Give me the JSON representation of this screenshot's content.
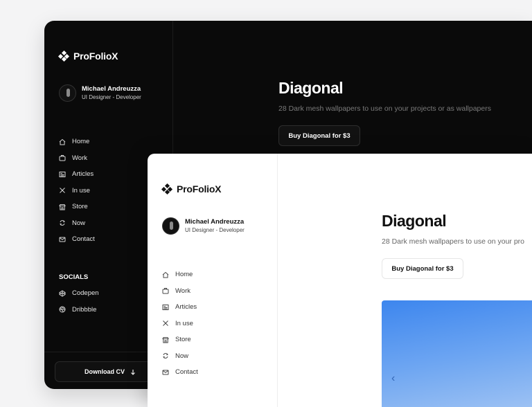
{
  "brand": {
    "name": "ProFolioX"
  },
  "profile": {
    "name": "Michael Andreuzza",
    "role": "UI Designer - Developer"
  },
  "nav": [
    {
      "label": "Home",
      "icon": "home-icon"
    },
    {
      "label": "Work",
      "icon": "briefcase-icon"
    },
    {
      "label": "Articles",
      "icon": "newspaper-icon"
    },
    {
      "label": "In use",
      "icon": "tools-icon"
    },
    {
      "label": "Store",
      "icon": "store-icon"
    },
    {
      "label": "Now",
      "icon": "refresh-icon"
    },
    {
      "label": "Contact",
      "icon": "mail-icon"
    }
  ],
  "socials": {
    "heading": "SOCIALS",
    "items": [
      {
        "label": "Codepen",
        "icon": "codepen-icon"
      },
      {
        "label": "Dribbble",
        "icon": "dribbble-icon"
      }
    ]
  },
  "download": {
    "label": "Download CV",
    "icon": "arrow-down-icon"
  },
  "product": {
    "title": "Diagonal",
    "subtitle": "28 Dark mesh wallpapers to use on your projects or as wallpapers",
    "subtitle_light": "28 Dark mesh wallpapers to use on your pro",
    "buy_label": "Buy Diagonal for $3"
  },
  "hero": {
    "prev_icon": "chevron-left-icon",
    "prev_glyph": "‹"
  },
  "colors": {
    "dark_bg": "#0a0a0a",
    "light_bg": "#ffffff",
    "page_bg": "#f4f4f5",
    "hero_blue": "#3d86ee"
  }
}
